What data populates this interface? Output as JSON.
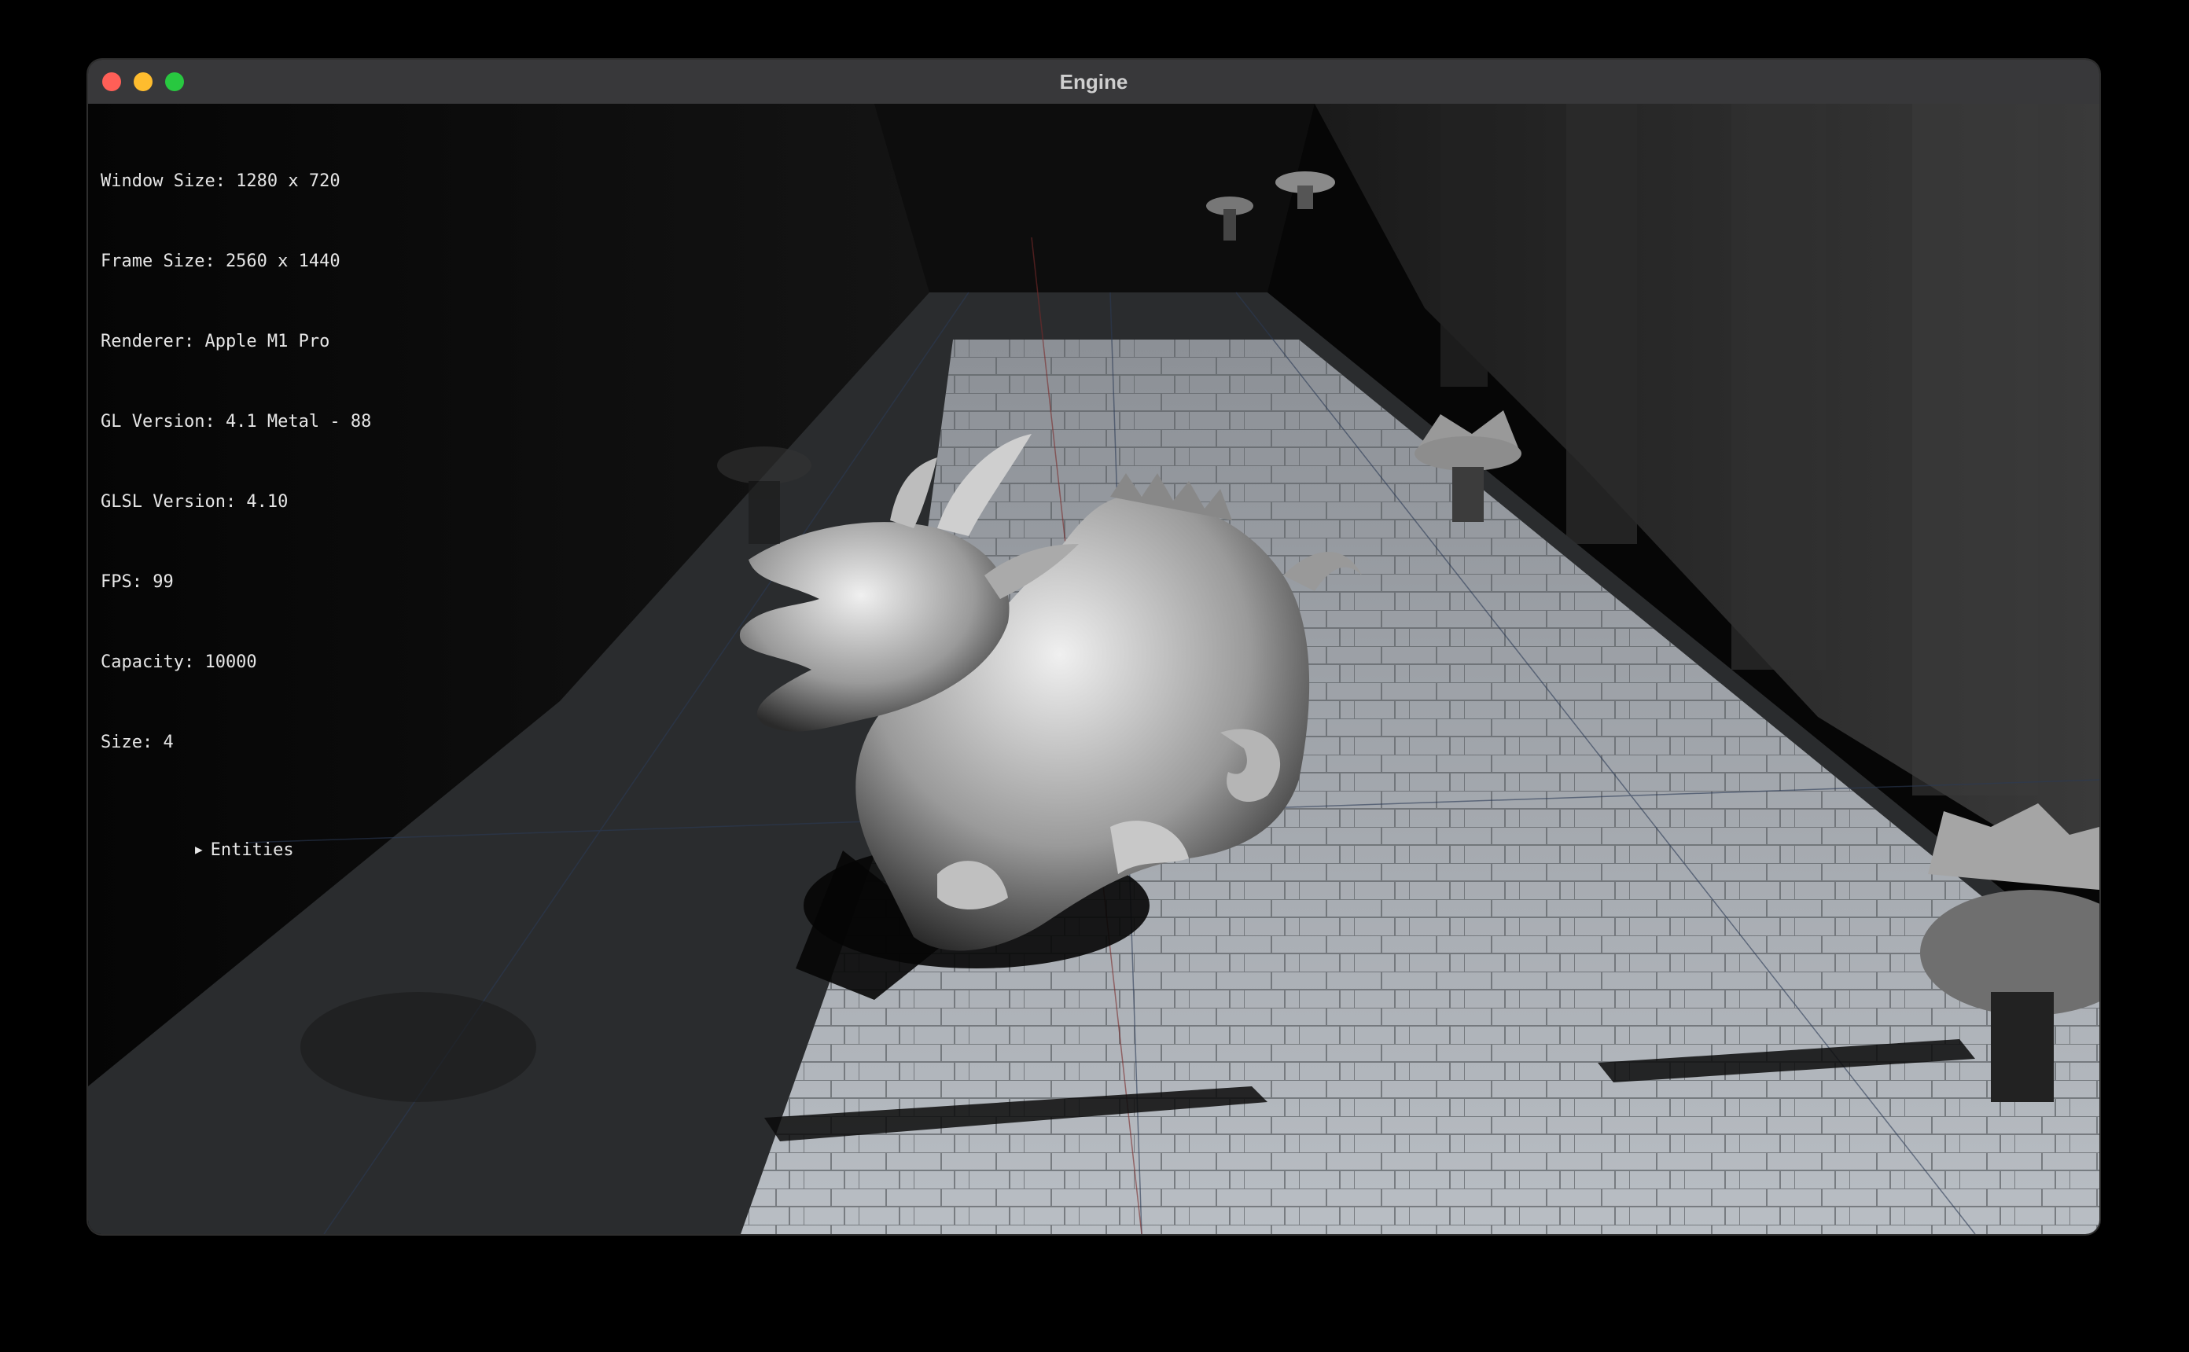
{
  "window": {
    "title": "Engine",
    "controls": {
      "close_color": "#ff5f57",
      "minimize_color": "#febc2e",
      "zoom_color": "#28c840"
    }
  },
  "debug_overlay": {
    "lines": [
      "Window Size: 1280 x 720",
      "Frame Size: 2560 x 1440",
      "Renderer: Apple M1 Pro",
      "GL Version: 4.1 Metal - 88",
      "GLSL Version: 4.10",
      "FPS: 99",
      "Capacity: 10000",
      "Size: 4"
    ],
    "tree": {
      "arrow": "▶",
      "label": "Entities",
      "expanded": false
    }
  },
  "scene": {
    "description_colors": {
      "floor": "#9aa0a6",
      "walls": "#1a1a1a",
      "shadow": "#050505"
    }
  }
}
